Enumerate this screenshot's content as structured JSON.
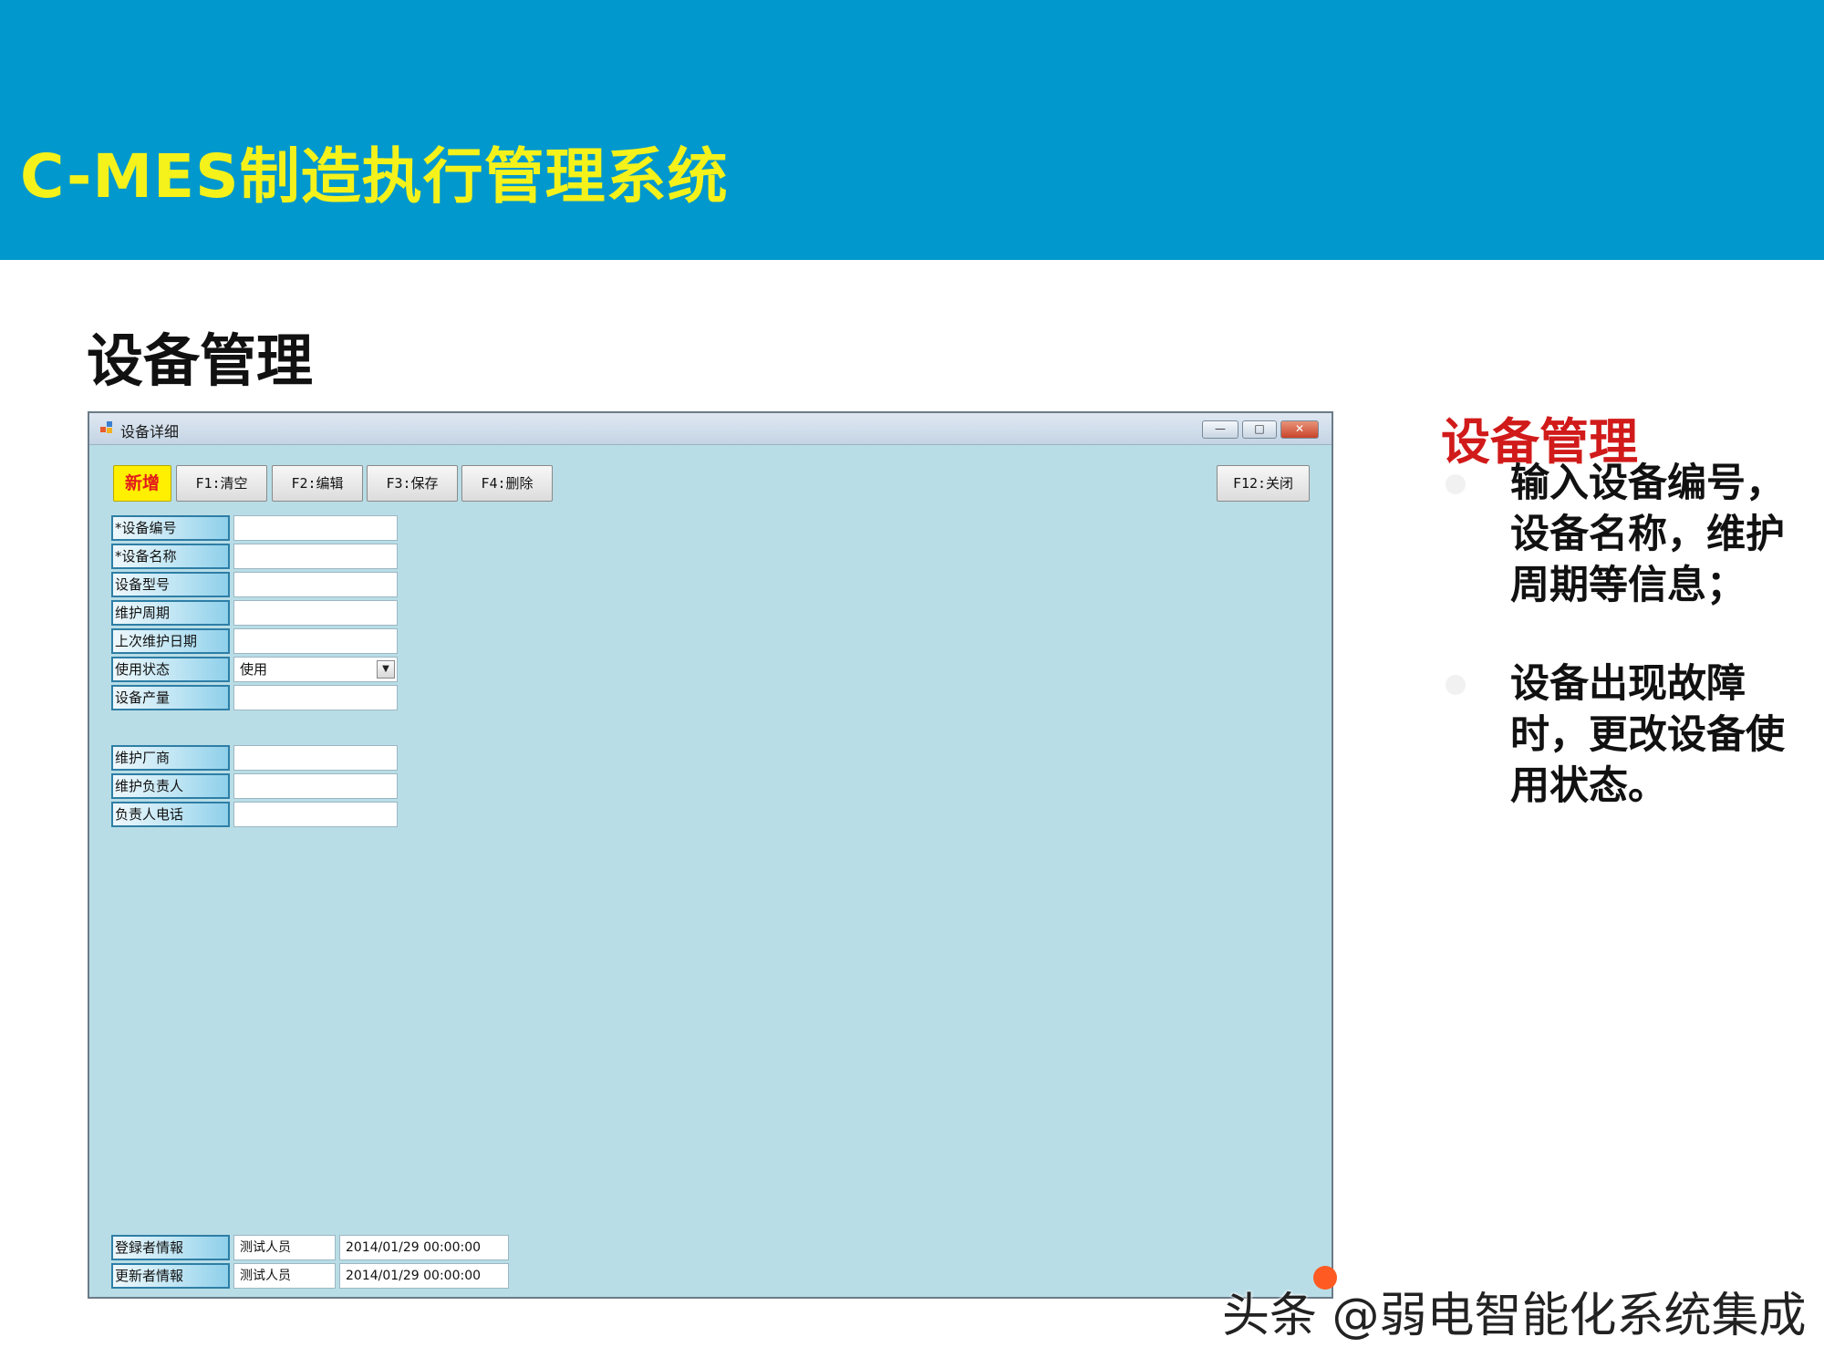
{
  "banner": {
    "title": "C-MES制造执行管理系统"
  },
  "section": {
    "title": "设备管理"
  },
  "window": {
    "title": "设备详细",
    "buttons": {
      "minimize": "—",
      "maximize": "□",
      "close": "✕"
    },
    "toolbar": {
      "new": "新增",
      "clear": "F1:清空",
      "edit": "F2:编辑",
      "save": "F3:保存",
      "delete": "F4:删除",
      "close": "F12:关闭"
    },
    "fields": [
      {
        "label": "*设备编号",
        "value": ""
      },
      {
        "label": "*设备名称",
        "value": ""
      },
      {
        "label": "设备型号",
        "value": ""
      },
      {
        "label": "维护周期",
        "value": ""
      },
      {
        "label": "上次维护日期",
        "value": ""
      },
      {
        "label": "使用状态",
        "value": "使用"
      },
      {
        "label": "设备产量",
        "value": ""
      }
    ],
    "vendor_fields": [
      {
        "label": "维护厂商",
        "value": ""
      },
      {
        "label": "维护负责人",
        "value": ""
      },
      {
        "label": "负责人电话",
        "value": ""
      }
    ],
    "footer": [
      {
        "label": "登録者情報",
        "user": "测试人员",
        "datetime": "2014/01/29 00:00:00"
      },
      {
        "label": "更新者情報",
        "user": "测试人员",
        "datetime": "2014/01/29 00:00:00"
      }
    ]
  },
  "sidebar": {
    "title": "设备管理",
    "bullets": [
      "输入设备编号，设备名称，维护周期等信息；",
      "设备出现故障时，更改设备使用状态。"
    ]
  },
  "watermark": "头条 @弱电智能化系统集成"
}
